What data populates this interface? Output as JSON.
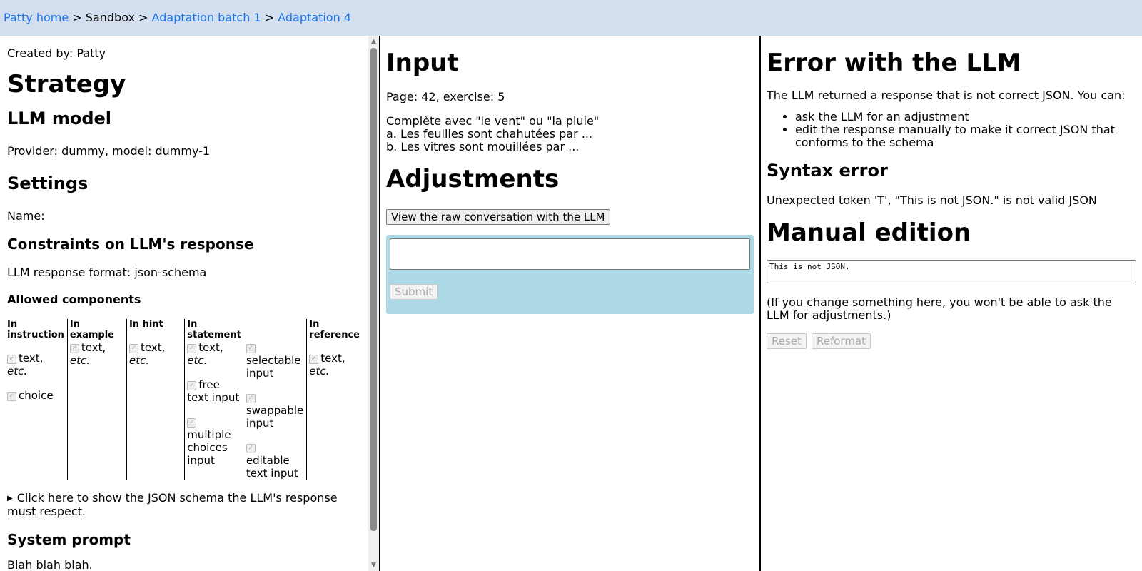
{
  "breadcrumb": {
    "home": "Patty home",
    "sep": ">",
    "sandbox": "Sandbox",
    "batch": "Adaptation batch 1",
    "adaptation": "Adaptation 4"
  },
  "left": {
    "created_by": "Created by: Patty",
    "strategy": "Strategy",
    "llm_model": "LLM model",
    "provider": "Provider: dummy, model: dummy-1",
    "settings": "Settings",
    "name": "Name:",
    "constraints": "Constraints on LLM's response",
    "format": "LLM response format: json-schema",
    "allowed": "Allowed components",
    "columns": {
      "instruction": "In instruction",
      "example": "In example",
      "hint": "In hint",
      "statement": "In statement",
      "reference": "In reference"
    },
    "items": {
      "text": "text,",
      "etc": "etc.",
      "choice": "choice",
      "free_text_input": "free text input",
      "multiple_choices_input": "multiple choices input",
      "selectable_input": "selectable input",
      "swappable_input": "swappable input",
      "editable_text_input": "editable text input"
    },
    "schema_toggle": "Click here to show the JSON schema the LLM's response must respect.",
    "system_prompt": "System prompt",
    "system_prompt_text": "Blah blah blah."
  },
  "middle": {
    "input_title": "Input",
    "page_exercise": "Page: 42, exercise: 5",
    "exercise_lines": [
      "Complète avec \"le vent\" ou \"la pluie\"",
      "a. Les feuilles sont chahutées par ...",
      "b. Les vitres sont mouillées par ..."
    ],
    "adjustments_title": "Adjustments",
    "raw_button": "View the raw conversation with the LLM",
    "adjust_placeholder": "",
    "submit": "Submit"
  },
  "right": {
    "error_title": "Error with the LLM",
    "error_desc": "The LLM returned a response that is not correct JSON. You can:",
    "options": [
      "ask the LLM for an adjustment",
      "edit the response manually to make it correct JSON that conforms to the schema"
    ],
    "syntax_title": "Syntax error",
    "syntax_msg": "Unexpected token 'T', \"This is not JSON.\" is not valid JSON",
    "manual_title": "Manual edition",
    "manual_value": "This is not JSON.",
    "manual_note": "(If you change something here, you won't be able to ask the LLM for adjustments.)",
    "reset": "Reset",
    "reformat": "Reformat"
  },
  "colors": {
    "breadcrumb_bg": "#d3dfef",
    "link": "#1a73e8",
    "adjust_box_bg": "#add8e6"
  }
}
